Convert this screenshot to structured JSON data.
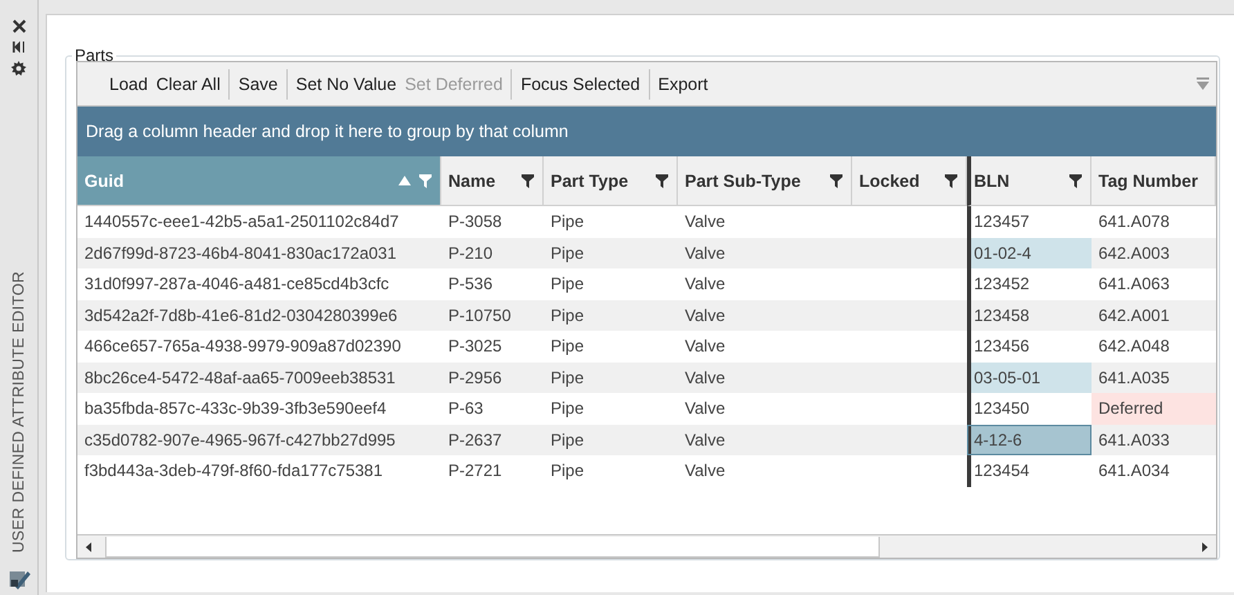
{
  "side_panel": {
    "title": "USER DEFINED ATTRIBUTE EDITOR"
  },
  "group": {
    "title": "Parts"
  },
  "toolbar": [
    [
      {
        "label": "Load",
        "disabled": false
      },
      {
        "label": "Clear All",
        "disabled": false
      }
    ],
    [
      {
        "label": "Save",
        "disabled": false
      }
    ],
    [
      {
        "label": "Set No Value",
        "disabled": false
      },
      {
        "label": "Set Deferred",
        "disabled": true
      }
    ],
    [
      {
        "label": "Focus Selected",
        "disabled": false
      }
    ],
    [
      {
        "label": "Export",
        "disabled": false
      }
    ]
  ],
  "group_panel": {
    "hint": "Drag a column header and drop it here to group by that column"
  },
  "columns": [
    {
      "label": "Guid",
      "selected": true,
      "sorted_ascending": true,
      "filter": true,
      "frozen_edge": false
    },
    {
      "label": "Name",
      "selected": false,
      "sorted_ascending": false,
      "filter": true,
      "frozen_edge": false
    },
    {
      "label": "Part Type",
      "selected": false,
      "sorted_ascending": false,
      "filter": true,
      "frozen_edge": false
    },
    {
      "label": "Part Sub-Type",
      "selected": false,
      "sorted_ascending": false,
      "filter": true,
      "frozen_edge": false
    },
    {
      "label": "Locked",
      "selected": false,
      "sorted_ascending": false,
      "filter": true,
      "frozen_edge": false
    },
    {
      "label": "BLN",
      "selected": false,
      "sorted_ascending": false,
      "filter": true,
      "frozen_edge": true
    },
    {
      "label": "Tag Number",
      "selected": false,
      "sorted_ascending": false,
      "filter": false,
      "frozen_edge": false
    }
  ],
  "rows": [
    {
      "cells": [
        {
          "text": "1440557c-eee1-42b5-a5a1-2501102c84d7"
        },
        {
          "text": "P-3058"
        },
        {
          "text": "Pipe"
        },
        {
          "text": "Valve"
        },
        {},
        {
          "text": "123457",
          "edited": false,
          "selected": false
        },
        {
          "text": "641.A078",
          "deferred": false
        }
      ]
    },
    {
      "cells": [
        {
          "text": "2d67f99d-8723-46b4-8041-830ac172a031"
        },
        {
          "text": "P-210"
        },
        {
          "text": "Pipe"
        },
        {
          "text": "Valve"
        },
        {},
        {
          "text": "01-02-4",
          "edited": true,
          "selected": false
        },
        {
          "text": "642.A003",
          "deferred": false
        }
      ]
    },
    {
      "cells": [
        {
          "text": "31d0f997-287a-4046-a481-ce85cd4b3cfc"
        },
        {
          "text": "P-536"
        },
        {
          "text": "Pipe"
        },
        {
          "text": "Valve"
        },
        {},
        {
          "text": "123452",
          "edited": false,
          "selected": false
        },
        {
          "text": "641.A063",
          "deferred": false
        }
      ]
    },
    {
      "cells": [
        {
          "text": "3d542a2f-7d8b-41e6-81d2-0304280399e6"
        },
        {
          "text": "P-10750"
        },
        {
          "text": "Pipe"
        },
        {
          "text": "Valve"
        },
        {},
        {
          "text": "123458",
          "edited": false,
          "selected": false
        },
        {
          "text": "642.A001",
          "deferred": false
        }
      ]
    },
    {
      "cells": [
        {
          "text": "466ce657-765a-4938-9979-909a87d02390"
        },
        {
          "text": "P-3025"
        },
        {
          "text": "Pipe"
        },
        {
          "text": "Valve"
        },
        {},
        {
          "text": "123456",
          "edited": false,
          "selected": false
        },
        {
          "text": "642.A048",
          "deferred": false
        }
      ]
    },
    {
      "cells": [
        {
          "text": "8bc26ce4-5472-48af-aa65-7009eeb38531"
        },
        {
          "text": "P-2956"
        },
        {
          "text": "Pipe"
        },
        {
          "text": "Valve"
        },
        {},
        {
          "text": "03-05-01",
          "edited": true,
          "selected": false
        },
        {
          "text": "641.A035",
          "deferred": false
        }
      ]
    },
    {
      "cells": [
        {
          "text": "ba35fbda-857c-433c-9b39-3fb3e590eef4"
        },
        {
          "text": "P-63"
        },
        {
          "text": "Pipe"
        },
        {
          "text": "Valve"
        },
        {},
        {
          "text": "123450",
          "edited": false,
          "selected": false
        },
        {
          "text": "Deferred",
          "deferred": true
        }
      ]
    },
    {
      "cells": [
        {
          "text": "c35d0782-907e-4965-967f-c427bb27d995"
        },
        {
          "text": "P-2637"
        },
        {
          "text": "Pipe"
        },
        {
          "text": "Valve"
        },
        {},
        {
          "text": "4-12-6",
          "edited": false,
          "selected": true
        },
        {
          "text": "641.A033",
          "deferred": false
        }
      ]
    },
    {
      "cells": [
        {
          "text": "f3bd443a-3deb-479f-8f60-fda177c75381"
        },
        {
          "text": "P-2721"
        },
        {
          "text": "Pipe"
        },
        {
          "text": "Valve"
        },
        {},
        {
          "text": "123454",
          "edited": false,
          "selected": false
        },
        {
          "text": "641.A034",
          "deferred": false
        }
      ]
    }
  ]
}
